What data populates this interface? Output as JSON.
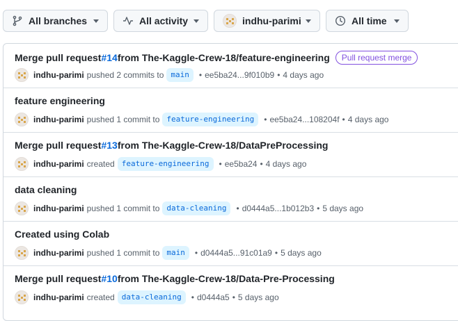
{
  "filters": {
    "branches": {
      "label": "All branches",
      "icon": "git-branch-icon"
    },
    "activity": {
      "label": "All activity",
      "icon": "pulse-icon"
    },
    "user": {
      "label": "indhu-parimi",
      "icon": "avatar"
    },
    "time": {
      "label": "All time",
      "icon": "clock-icon"
    }
  },
  "activities": [
    {
      "title_prefix": "Merge pull request ",
      "pr": "#14",
      "title_suffix": " from The-Kaggle-Crew-18/feature-engineering",
      "badge": "Pull request merge",
      "user": "indhu-parimi",
      "action": "pushed 2 commits to",
      "branch": "main",
      "sha": "ee5ba24...9f010b9",
      "time": "4 days ago"
    },
    {
      "title_prefix": "feature engineering",
      "pr": "",
      "title_suffix": "",
      "badge": "",
      "user": "indhu-parimi",
      "action": "pushed 1 commit to",
      "branch": "feature-engineering",
      "sha": "ee5ba24...108204f",
      "time": "4 days ago"
    },
    {
      "title_prefix": "Merge pull request ",
      "pr": "#13",
      "title_suffix": " from The-Kaggle-Crew-18/DataPreProcessing",
      "badge": "",
      "user": "indhu-parimi",
      "action": "created",
      "branch": "feature-engineering",
      "sha": "ee5ba24",
      "time": "4 days ago"
    },
    {
      "title_prefix": "data cleaning",
      "pr": "",
      "title_suffix": "",
      "badge": "",
      "user": "indhu-parimi",
      "action": "pushed 1 commit to",
      "branch": "data-cleaning",
      "sha": "d0444a5...1b012b3",
      "time": "5 days ago"
    },
    {
      "title_prefix": "Created using Colab",
      "pr": "",
      "title_suffix": "",
      "badge": "",
      "user": "indhu-parimi",
      "action": "pushed 1 commit to",
      "branch": "main",
      "sha": "d0444a5...91c01a9",
      "time": "5 days ago"
    },
    {
      "title_prefix": "Merge pull request ",
      "pr": "#10",
      "title_suffix": " from The-Kaggle-Crew-18/Data-Pre-Processing",
      "badge": "",
      "user": "indhu-parimi",
      "action": "created",
      "branch": "data-cleaning",
      "sha": "d0444a5",
      "time": "5 days ago"
    }
  ],
  "colors": {
    "link": "#0969da",
    "badge": "#8250df",
    "branch_bg": "#ddf4ff"
  }
}
